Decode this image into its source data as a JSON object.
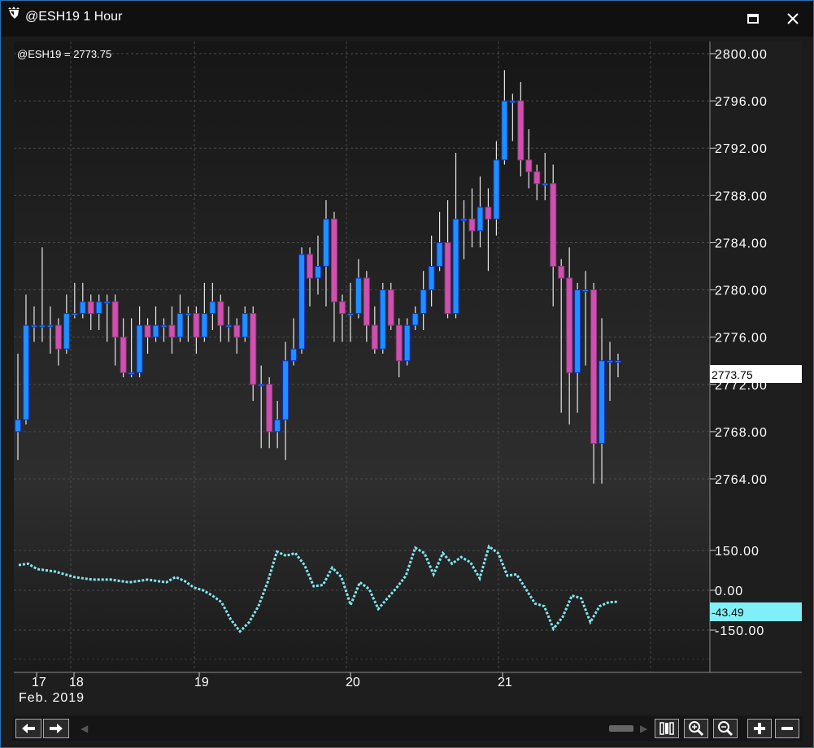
{
  "window": {
    "title": "@ESH19 1 Hour",
    "maximize_icon": "maximize-icon",
    "close_icon": "close-icon"
  },
  "colors": {
    "up_candle": "#1e90ff",
    "down_candle": "#d050b0",
    "indicator": "#80e8f0",
    "price_marker_bg": "#ffffff",
    "indicator_marker_bg": "#80f0f8"
  },
  "price_chart": {
    "label": "@ESH19 = 2773.75",
    "last_price": "2773.75",
    "y_ticks": [
      "2800.00",
      "2796.00",
      "2792.00",
      "2788.00",
      "2784.00",
      "2780.00",
      "2776.00",
      "2772.00",
      "2768.00",
      "2764.00"
    ]
  },
  "indicator_chart": {
    "last_value": "-43.49",
    "y_ticks": [
      "150.00",
      "0.00",
      "-150.00"
    ]
  },
  "x_axis": {
    "labels": [
      "17",
      "18",
      "19",
      "20",
      "21"
    ],
    "sublabel": "Feb. 2019"
  },
  "toolbar": {
    "back_icon": "arrow-left-icon",
    "forward_icon": "arrow-right-icon",
    "icons": [
      "fit-bars-icon",
      "zoom-in-icon",
      "zoom-out-icon",
      "plus-icon",
      "minus-icon"
    ]
  },
  "chart_data": [
    {
      "type": "candlestick",
      "symbol": "@ESH19",
      "interval": "1 Hour",
      "ylim": [
        2761,
        2801
      ],
      "grid": true,
      "candles": [
        [
          2769,
          2774,
          2768,
          2766
        ],
        [
          2777,
          2779,
          2774,
          2776
        ],
        [
          2777,
          2778,
          2777,
          2776
        ],
        [
          2777,
          2783,
          2774,
          2776
        ],
        [
          2777,
          2778,
          2774,
          2775
        ],
        [
          2775,
          2777,
          2775,
          2774
        ],
        [
          2778,
          2779,
          2776,
          2775
        ],
        [
          2778,
          2780,
          2777,
          2778
        ],
        [
          2779,
          2780,
          2777,
          2778
        ],
        [
          2778,
          2779,
          2776,
          2777
        ],
        [
          2779,
          2779,
          2778,
          2777
        ],
        [
          2779,
          2779,
          2776,
          2776
        ],
        [
          2776,
          2777,
          2775,
          2774
        ],
        [
          2773,
          2777,
          2773,
          2773
        ],
        [
          2773,
          2777,
          2773,
          2775
        ],
        [
          2777,
          2778,
          2776,
          2776
        ],
        [
          2776,
          2777,
          2775,
          2775
        ],
        [
          2777,
          2778,
          2777,
          2776
        ],
        [
          2777,
          2777,
          2776,
          2776
        ],
        [
          2776,
          2778,
          2776,
          2775
        ],
        [
          2778,
          2779,
          2776,
          2776
        ],
        [
          2778,
          2778,
          2776,
          2776
        ],
        [
          2776,
          2778,
          2776,
          2775
        ],
        [
          2778,
          2780,
          2777,
          2776
        ],
        [
          2779,
          2780,
          2777,
          2777
        ],
        [
          2777,
          2778,
          2776,
          2776
        ],
        [
          2777,
          2778,
          2776,
          2776
        ],
        [
          2776,
          2777,
          2776,
          2775
        ],
        [
          2778,
          2778,
          2775,
          2777
        ],
        [
          2772,
          2778,
          2770,
          2771
        ],
        [
          2772,
          2773,
          2768,
          2767
        ],
        [
          2768,
          2770,
          2767,
          2767
        ],
        [
          2769,
          2770,
          2768,
          2767
        ],
        [
          2774,
          2775,
          2768,
          2766
        ],
        [
          2775,
          2777,
          2774,
          2775
        ],
        [
          2783,
          2783,
          2775,
          2775
        ],
        [
          2781,
          2783,
          2780,
          2779
        ],
        [
          2782,
          2784,
          2780,
          2780
        ],
        [
          2786,
          2787,
          2781,
          2779
        ],
        [
          2779,
          2780,
          2777,
          2776
        ],
        [
          2778,
          2779,
          2777,
          2776
        ],
        [
          2778,
          2780,
          2777,
          2776
        ],
        [
          2781,
          2782,
          2778,
          2778
        ],
        [
          2777,
          2781,
          2776,
          2776
        ],
        [
          2775,
          2778,
          2775,
          2775
        ],
        [
          2780,
          2780,
          2776,
          2775
        ],
        [
          2777,
          2779,
          2778,
          2777
        ],
        [
          2774,
          2777,
          2774,
          2773
        ],
        [
          2777,
          2777,
          2777,
          2776
        ],
        [
          2778,
          2778,
          2777,
          2777
        ],
        [
          2780,
          2781,
          2778,
          2777
        ],
        [
          2782,
          2784,
          2781,
          2779
        ],
        [
          2784,
          2786,
          2783,
          2782
        ],
        [
          2778,
          2787,
          2773,
          2778
        ],
        [
          2786,
          2791,
          2784,
          2780
        ],
        [
          2786,
          2787,
          2784,
          2783
        ],
        [
          2785,
          2788,
          2785,
          2784
        ],
        [
          2787,
          2789,
          2786,
          2784
        ],
        [
          2786,
          2788,
          2782,
          2782
        ],
        [
          2791,
          2792,
          2785,
          2785
        ],
        [
          2796,
          2798,
          2792,
          2791
        ],
        [
          2796,
          2796,
          2795,
          2793
        ],
        [
          2791,
          2797,
          2791,
          2790
        ],
        [
          2790,
          2793,
          2789,
          2789
        ],
        [
          2789,
          2790,
          2789,
          2788
        ],
        [
          2789,
          2791,
          2789,
          2788
        ],
        [
          2782,
          2790,
          2782,
          2779
        ],
        [
          2781,
          2782,
          2773,
          2770
        ],
        [
          2773,
          2783,
          2773,
          2769
        ],
        [
          2780,
          2780,
          2773,
          2770
        ],
        [
          2780,
          2781,
          2778,
          2774
        ],
        [
          2767,
          2778,
          2767,
          2764
        ],
        [
          2774,
          2777,
          2767,
          2764
        ],
        [
          2774,
          2775,
          2774,
          2771
        ],
        [
          2774,
          2774,
          2774,
          2773
        ]
      ],
      "candle_order": "close, high_body_top, low_body_bottom, low_wick",
      "last": 2773.75
    },
    {
      "type": "line",
      "style": "dotted",
      "ylim": [
        -230,
        240
      ],
      "values": [
        95,
        100,
        80,
        75,
        70,
        60,
        50,
        45,
        40,
        40,
        40,
        35,
        30,
        35,
        40,
        35,
        30,
        50,
        35,
        10,
        0,
        -20,
        -45,
        -110,
        -155,
        -120,
        -60,
        30,
        145,
        130,
        140,
        95,
        15,
        20,
        85,
        50,
        -55,
        30,
        5,
        -70,
        -30,
        10,
        55,
        160,
        140,
        60,
        140,
        100,
        125,
        105,
        45,
        165,
        140,
        55,
        60,
        5,
        -50,
        -60,
        -145,
        -100,
        -20,
        -30,
        -120,
        -60,
        -45,
        -43.49
      ],
      "last": -43.49
    }
  ]
}
